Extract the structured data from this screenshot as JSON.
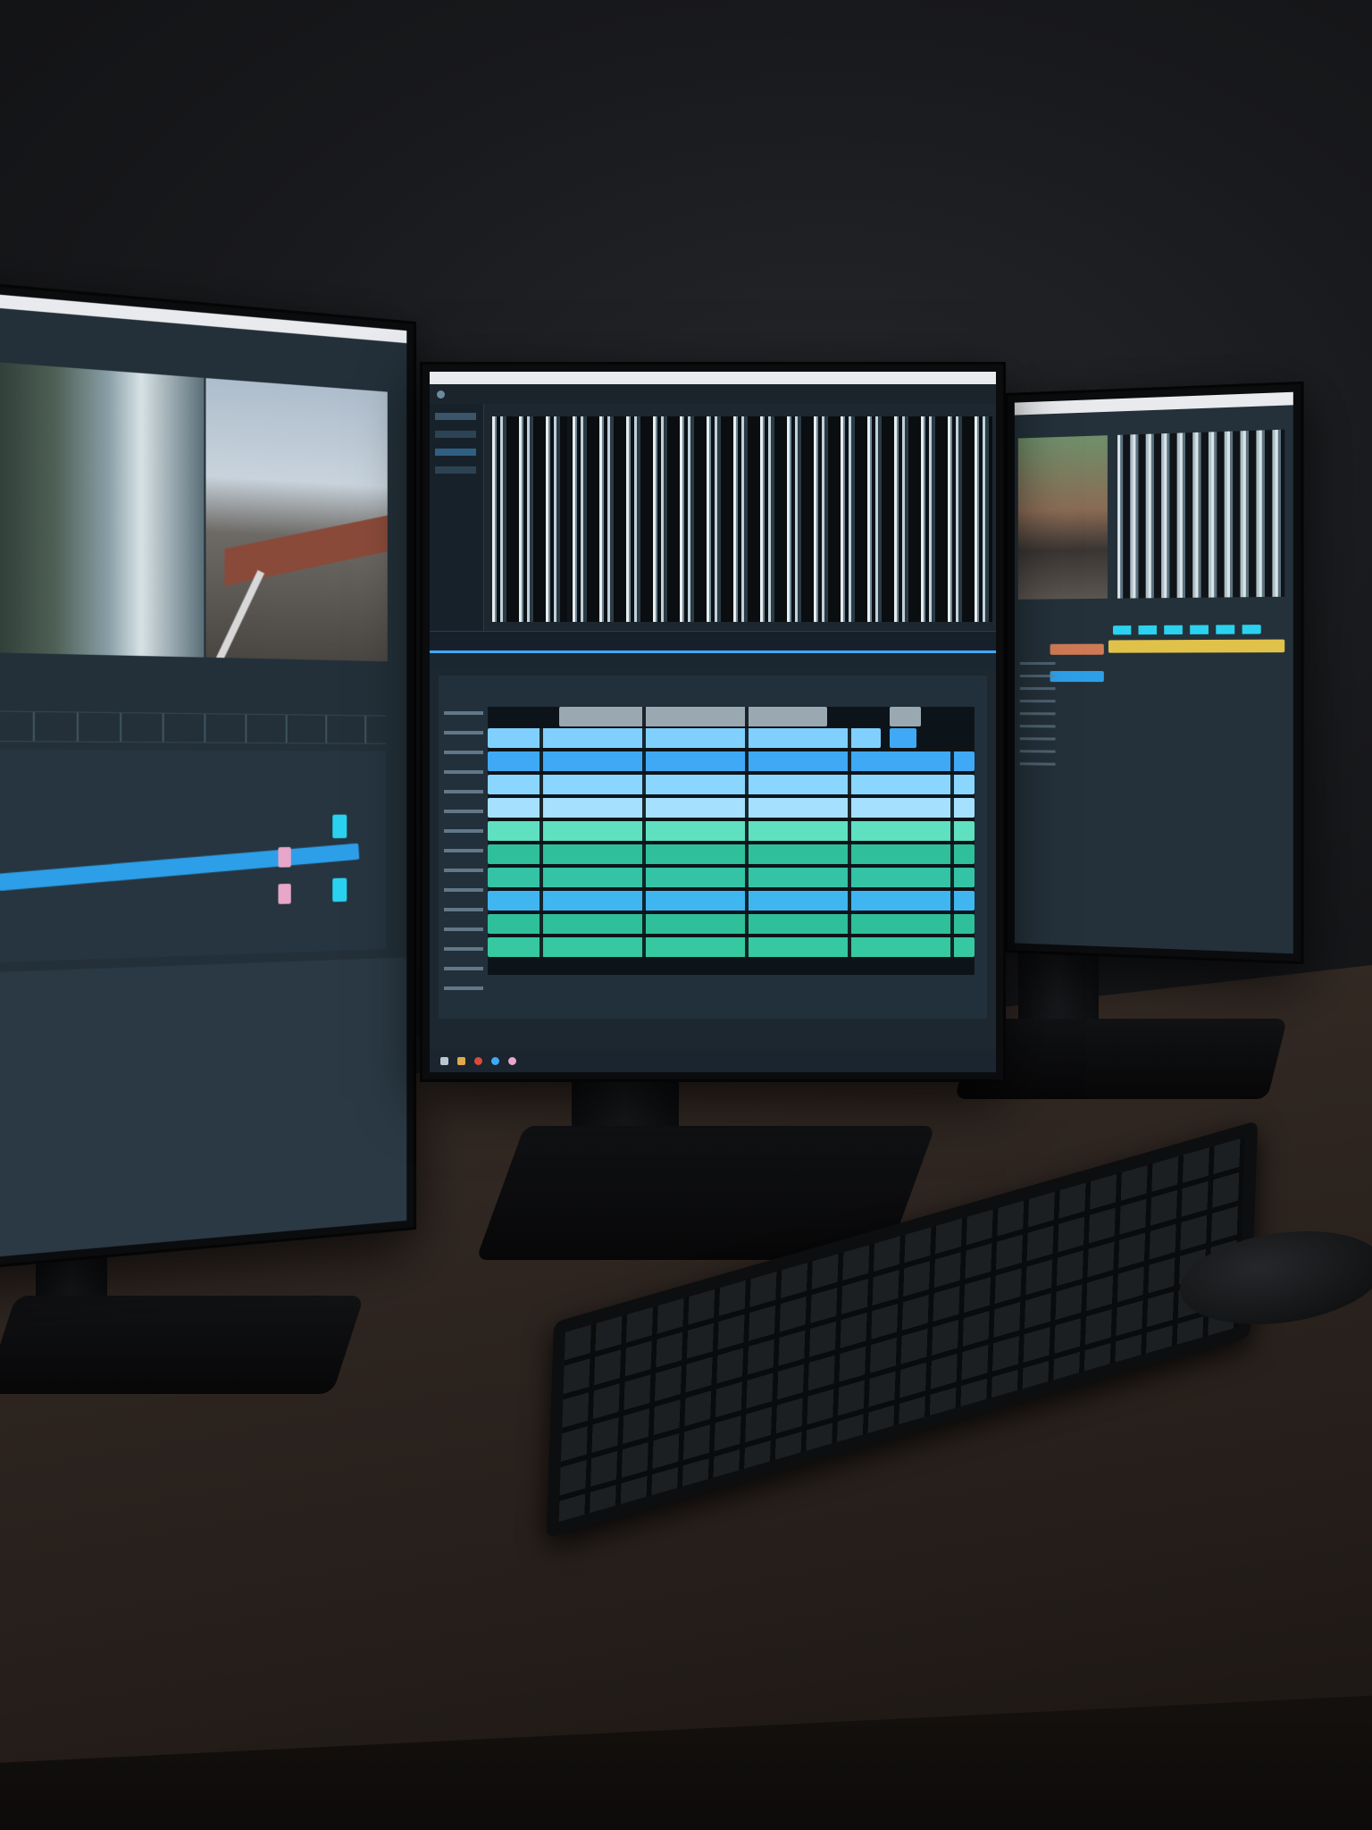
{
  "scene": {
    "description_colors": {
      "accent_blue": "#3fa9f5",
      "accent_teal": "#2fbf9a",
      "accent_light_blue": "#7fd0ff",
      "accent_yellow": "#e0c24a",
      "accent_orange": "#d07a55",
      "accent_pink": "#e8a6c8"
    }
  },
  "center_monitor": {
    "menu": [
      "",
      "",
      "",
      "",
      ""
    ],
    "track_labels": [
      "",
      "",
      "",
      "",
      "",
      "",
      "",
      "",
      "",
      "",
      "",
      "",
      ""
    ]
  },
  "icons": [
    "keyboard-icon",
    "mouse-icon"
  ]
}
